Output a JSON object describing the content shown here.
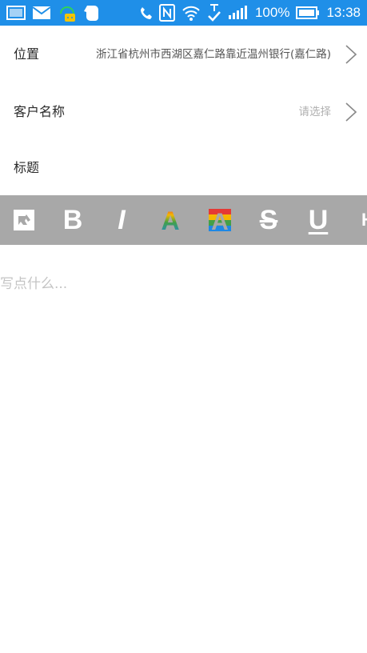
{
  "status_bar": {
    "battery": "100%",
    "time": "13:38",
    "icons": [
      "image-icon",
      "mail-icon",
      "chat-bot-icon",
      "evernote-icon",
      "phone-icon",
      "nfc-icon",
      "wifi-icon",
      "download-check-icon",
      "signal-icon",
      "battery-icon"
    ]
  },
  "form": {
    "location": {
      "label": "位置",
      "value": "浙江省杭州市西湖区嘉仁路靠近温州银行(嘉仁路)"
    },
    "customer": {
      "label": "客户名称",
      "placeholder": "请选择"
    },
    "title": {
      "label": "标题"
    }
  },
  "toolbar": {
    "bold": "B",
    "italic": "I",
    "text_color": "A",
    "highlight": "A",
    "strikethrough": "S",
    "underline": "U",
    "heading": "H"
  },
  "editor": {
    "placeholder": "写点什么..."
  },
  "colors": {
    "status_bar": "#1f8fe8",
    "toolbar": "#a8a8a8"
  }
}
